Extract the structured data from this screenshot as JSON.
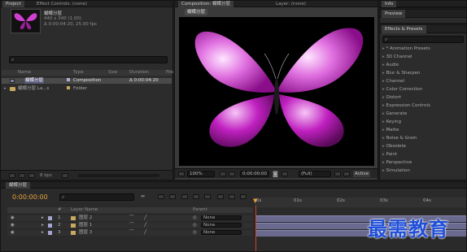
{
  "project": {
    "tab": "Project",
    "tab2": "Effect Controls: (none)",
    "item_name": "蝴蝶分层",
    "item_size": "440 x 340 (1.00)",
    "item_duration": "Δ 0:00:04:20, 25.00 fps",
    "columns": [
      "Name",
      "Type",
      "Size",
      "Duration",
      "File"
    ],
    "rows": [
      {
        "name": "蝴蝶分层",
        "type": "Composition",
        "size": "",
        "duration": "Δ 0:00:04:20"
      },
      {
        "name": "蝴蝶分层 La...s",
        "type": "Folder",
        "size": "",
        "duration": ""
      }
    ],
    "bpc": "8 bpc"
  },
  "composition": {
    "tab": "Composition: 蝴蝶分层",
    "tab2": "Layer: (none)",
    "sub_tab": "蝴蝶分层",
    "zoom": "100%",
    "timecode": "0:00:00:00",
    "resolution": "(Full)",
    "view": "Active"
  },
  "right": {
    "info_tab": "Info",
    "preview_tab": "Preview",
    "effects_tab": "Effects & Presets",
    "effects": [
      "* Animation Presets",
      "3D Channel",
      "Audio",
      "Blur & Sharpen",
      "Channel",
      "Color Correction",
      "Distort",
      "Expression Controls",
      "Generate",
      "Keying",
      "Matte",
      "Noise & Grain",
      "Obsolete",
      "Paint",
      "Perspective",
      "Simulation"
    ]
  },
  "timeline": {
    "tab": "蝴蝶分层",
    "timecode": "0:00:00:00",
    "col_layer_name": "Layer Name",
    "col_parent": "Parent",
    "ruler": [
      "0s",
      "01s",
      "02s",
      "03s",
      "04s"
    ],
    "layers": [
      {
        "num": "1",
        "name": "图层 2",
        "parent": "None"
      },
      {
        "num": "2",
        "name": "图层 1",
        "parent": "None"
      },
      {
        "num": "3",
        "name": "图层 3",
        "parent": "None"
      }
    ],
    "bar_color": "#6a6a8f"
  },
  "watermark": "最需教育",
  "colors": {
    "accent_orange": "#e8a23c",
    "butterfly": "#c020c0"
  }
}
